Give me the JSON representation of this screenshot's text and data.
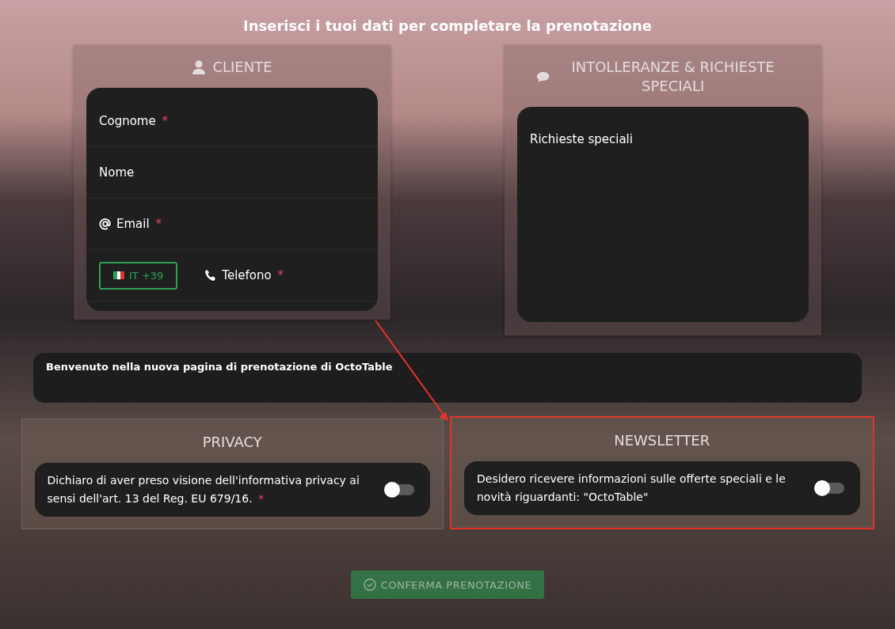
{
  "title": "Inserisci i tuoi dati per completare la prenotazione",
  "customer": {
    "heading": "CLIENTE",
    "fields": [
      {
        "kind": "text",
        "label": "Cognome",
        "required_mark": "*"
      },
      {
        "kind": "text",
        "label": "Nome"
      },
      {
        "kind": "email",
        "label": "Email",
        "required_mark": "*"
      },
      {
        "kind": "phone",
        "label": "Telefono",
        "required_mark": "*",
        "country": "IT +39"
      }
    ]
  },
  "requests": {
    "heading": "INTOLLERANZE & RICHIESTE SPECIALI",
    "placeholder": "Richieste speciali"
  },
  "welcome": "Benvenuto nella nuova pagina di prenotazione di OctoTable",
  "consents": [
    {
      "heading": "PRIVACY",
      "text": "Dichiaro di aver preso visione dell'informativa privacy ai sensi dell'art. 13 del Reg. EU 679/16.",
      "required_mark": "*",
      "on": false,
      "highlighted": false
    },
    {
      "heading": "NEWSLETTER",
      "text": "Desidero ricevere informazioni sulle offerte speciali e le novità riguardanti: \"OctoTable\"",
      "on": false,
      "highlighted": true
    }
  ],
  "confirm": {
    "label": "CONFERMA PRENOTAZIONE",
    "disabled": true
  }
}
